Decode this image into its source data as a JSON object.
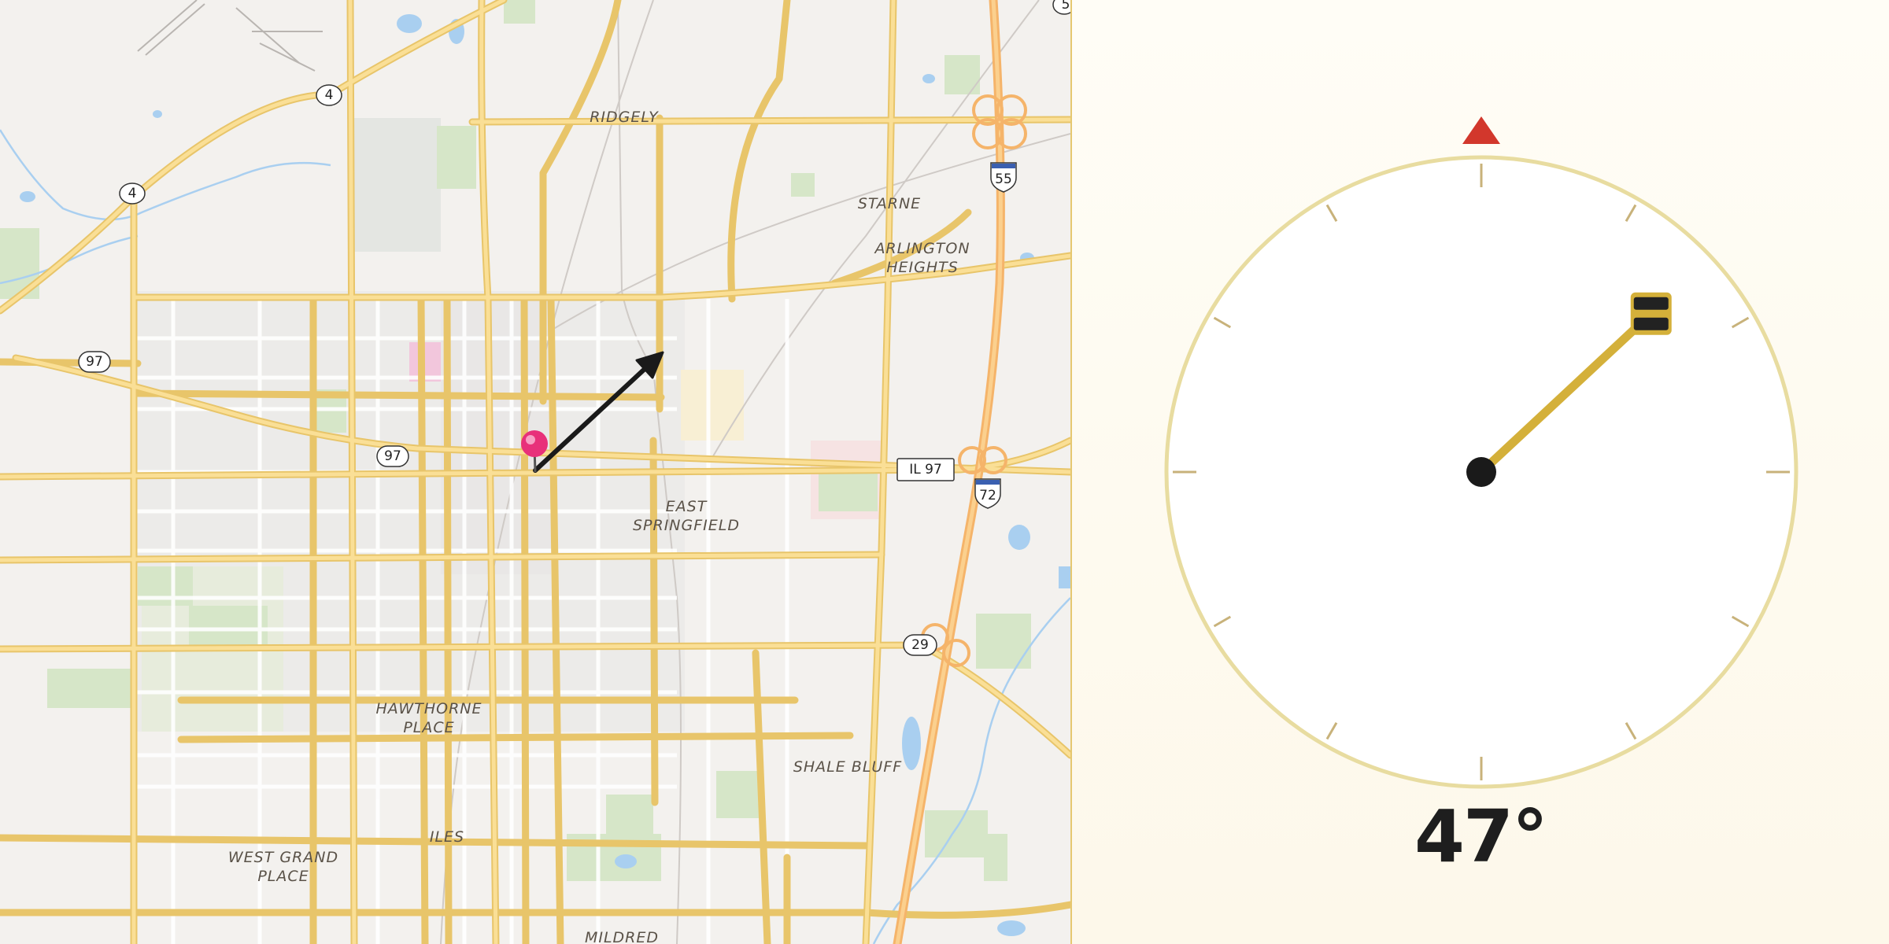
{
  "map": {
    "places": {
      "ridgely": "RIDGELY",
      "starne": "STARNE",
      "arlington_1": "ARLINGTON",
      "arlington_2": "HEIGHTS",
      "east_1": "EAST",
      "east_2": "SPRINGFIELD",
      "hawthorne_1": "HAWTHORNE",
      "hawthorne_2": "PLACE",
      "shale_bluff": "SHALE BLUFF",
      "iles": "ILES",
      "west_grand_1": "WEST GRAND",
      "west_grand_2": "PLACE",
      "mildred": "MILDRED"
    },
    "shields": {
      "route_4_north": "4",
      "route_4_west": "4",
      "route_97_west": "97",
      "route_97_center": "97",
      "il_97": "IL 97",
      "route_29": "29",
      "interstate_55": "55",
      "interstate_72": "72",
      "corner_route": "5"
    },
    "marker_icon": "map-pin-icon",
    "direction_icon": "direction-arrow-icon"
  },
  "compass": {
    "heading_deg": 47,
    "heading_label": "47°",
    "north_icon": "north-triangle-icon",
    "accent_color": "#d4b03a",
    "north_color": "#d2372c",
    "ring_color": "#e8dca0"
  }
}
